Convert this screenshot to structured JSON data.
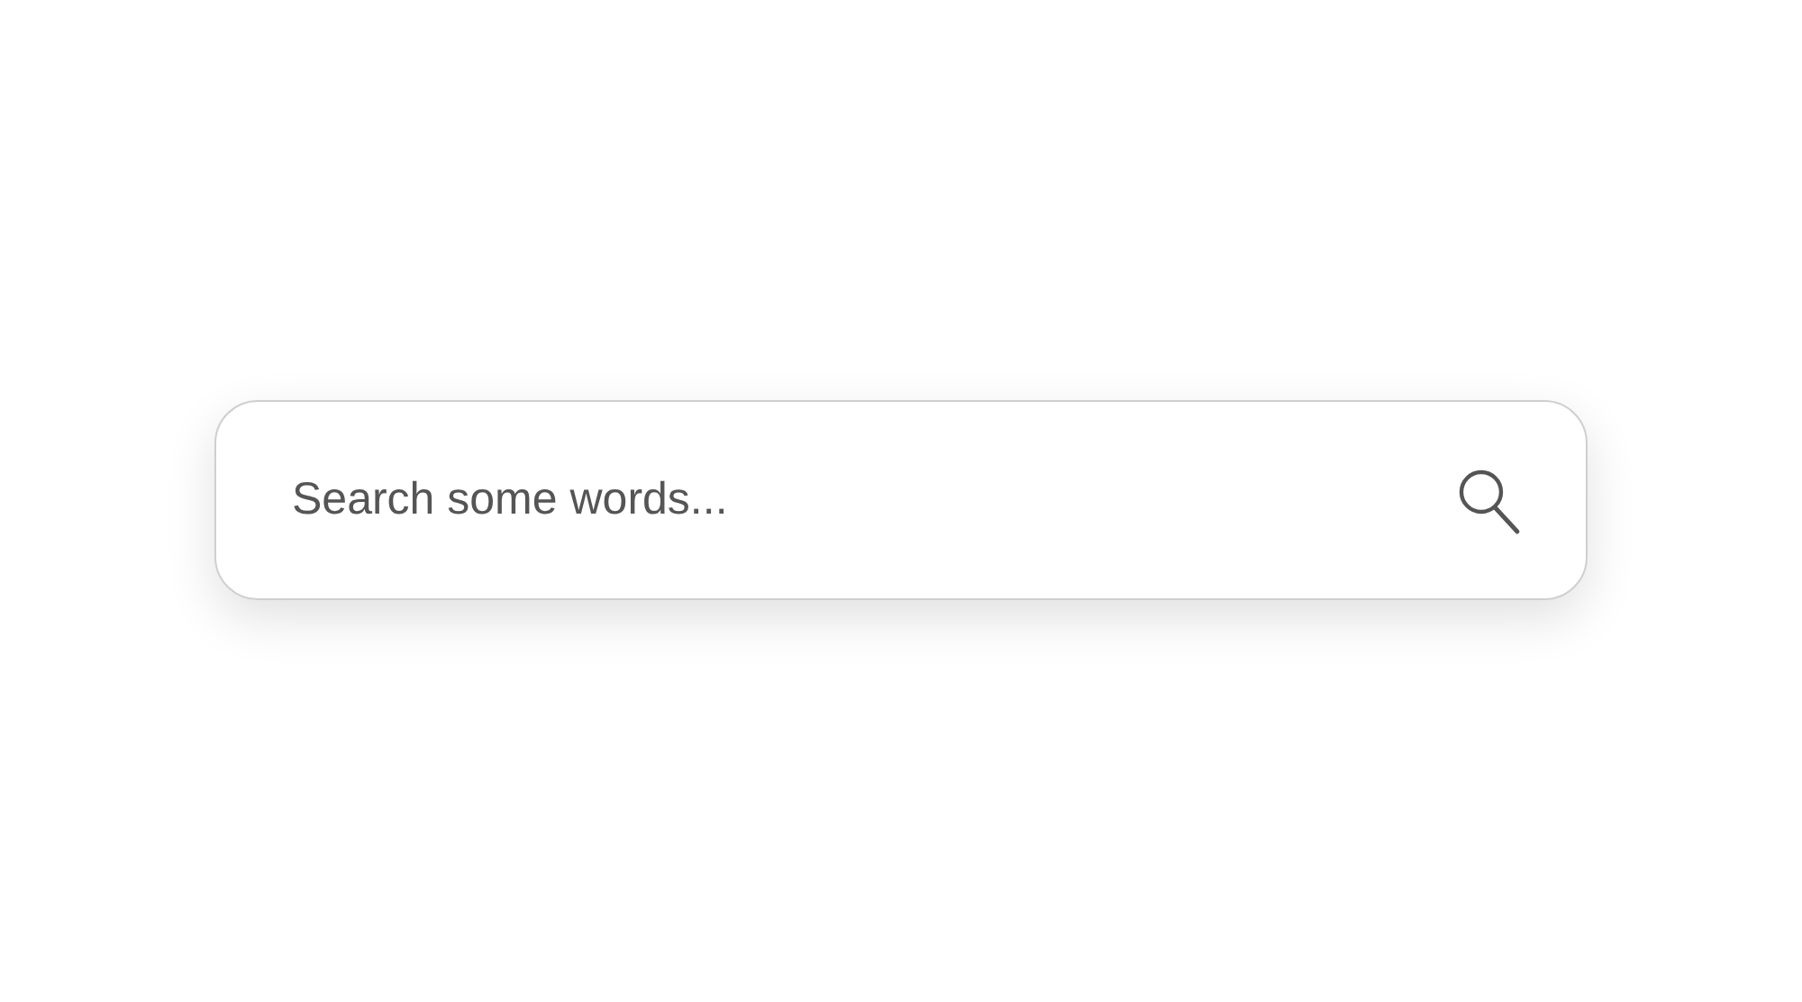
{
  "search": {
    "placeholder": "Search some words..."
  }
}
